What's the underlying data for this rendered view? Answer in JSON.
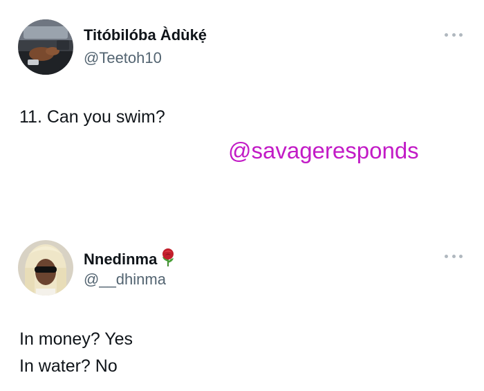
{
  "tweets": [
    {
      "display_name": "Titóbilóba Àdùkẹ́",
      "handle": "@Teetoh10",
      "avatar_icon": "avatar-photo-icon",
      "more_icon": "more-options-icon",
      "lines": [
        "11. Can you swim?"
      ]
    },
    {
      "display_name": "Nnedinma",
      "name_emoji": "rose-emoji-icon",
      "handle": "@__dhinma",
      "avatar_icon": "avatar-photo-icon",
      "more_icon": "more-options-icon",
      "lines": [
        "In money? Yes",
        "In water? No"
      ]
    }
  ],
  "watermark": "@savageresponds",
  "colors": {
    "watermark": "#c21bc6",
    "handle": "#536471",
    "text": "#0f1419",
    "more_dots": "#b0b8bf"
  }
}
